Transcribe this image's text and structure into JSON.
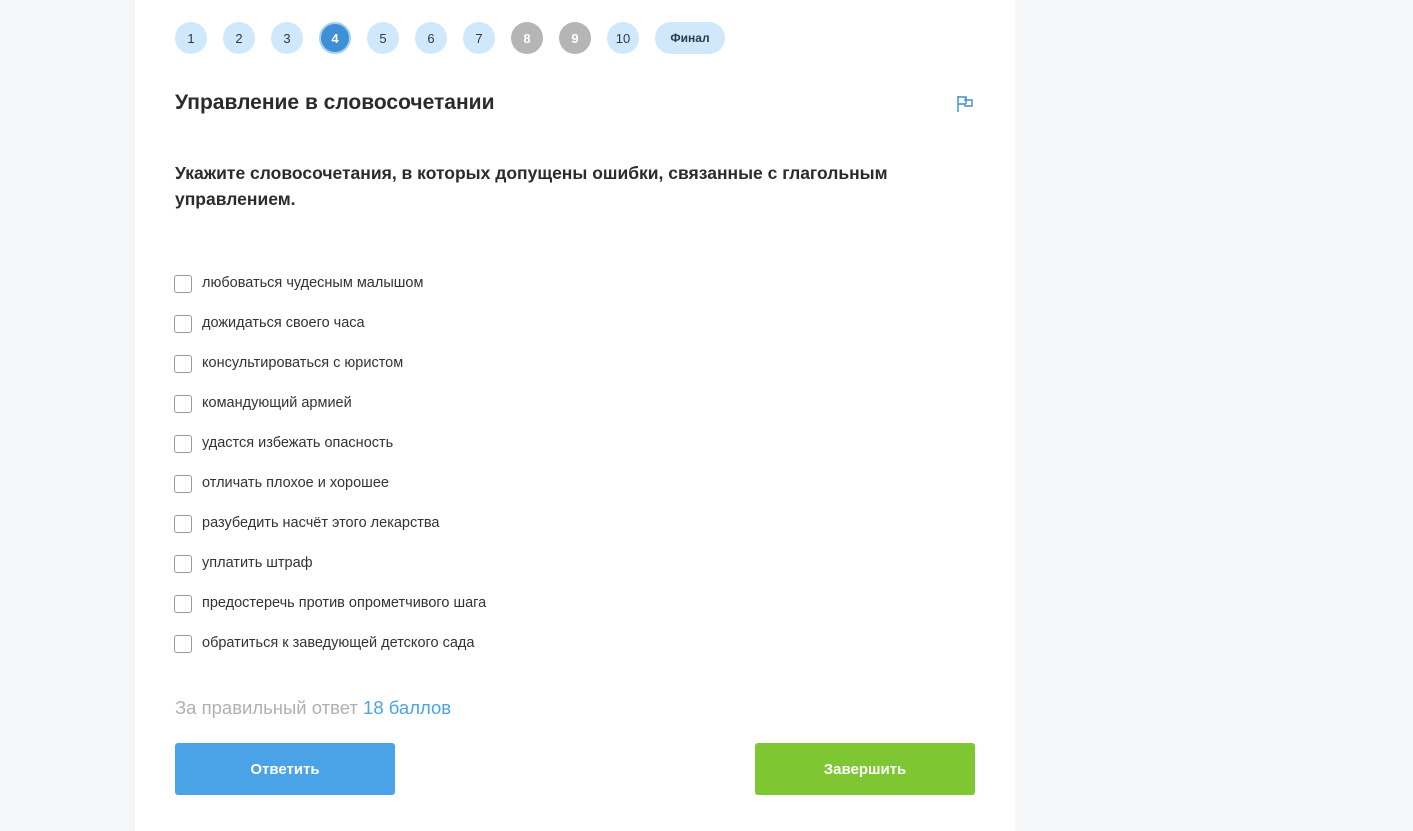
{
  "pager": {
    "items": [
      {
        "label": "1",
        "state": "normal"
      },
      {
        "label": "2",
        "state": "normal"
      },
      {
        "label": "3",
        "state": "normal"
      },
      {
        "label": "4",
        "state": "current"
      },
      {
        "label": "5",
        "state": "normal"
      },
      {
        "label": "6",
        "state": "normal"
      },
      {
        "label": "7",
        "state": "normal"
      },
      {
        "label": "8",
        "state": "done"
      },
      {
        "label": "9",
        "state": "done"
      },
      {
        "label": "10",
        "state": "normal"
      }
    ],
    "final_label": "Финал"
  },
  "task": {
    "title": "Управление в словосочетании",
    "flag_icon": "flag-icon",
    "question": "Укажите словосочетания, в которых допущены ошибки, связанные с глагольным управлением."
  },
  "options": [
    "любоваться чудесным малышом",
    "дожидаться своего часа",
    "консультироваться с юристом",
    "командующий армией",
    "удастся избежать опасность",
    "отличать плохое и хорошее",
    "разубедить насчёт этого лекарства",
    "уплатить штраф",
    "предостеречь против опрометчивого шага",
    "обратиться к заведующей детского сада"
  ],
  "score": {
    "prefix": "За правильный ответ",
    "points": "18 баллов"
  },
  "buttons": {
    "answer": "Ответить",
    "finish": "Завершить"
  },
  "colors": {
    "accent_blue": "#4aa3e6",
    "accent_green": "#7ec733",
    "current_page": "#3d8fd6",
    "pager_bg": "#cfe8fb",
    "done_page": "#b5b5b5"
  }
}
